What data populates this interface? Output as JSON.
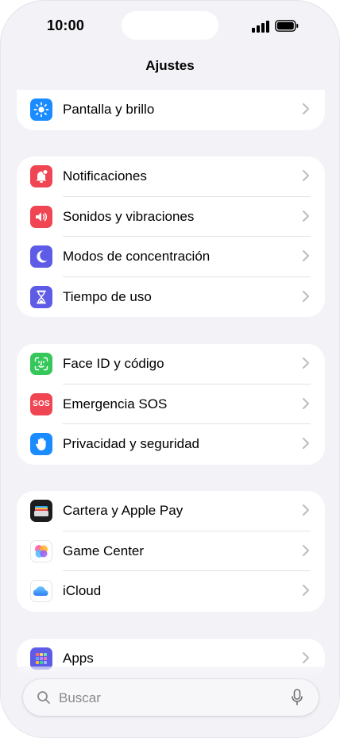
{
  "status_bar": {
    "time": "10:00"
  },
  "nav": {
    "title": "Ajustes"
  },
  "groups": [
    {
      "rows": [
        {
          "label": "Pantalla y brillo",
          "icon": "sun-icon",
          "color": "#1a8cff"
        }
      ]
    },
    {
      "rows": [
        {
          "label": "Notificaciones",
          "icon": "bell-icon",
          "color": "#f04552"
        },
        {
          "label": "Sonidos y vibraciones",
          "icon": "speaker-icon",
          "color": "#f04552"
        },
        {
          "label": "Modos de concentración",
          "icon": "moon-icon",
          "color": "#5e5ce6"
        },
        {
          "label": "Tiempo de uso",
          "icon": "hourglass-icon",
          "color": "#5e5ce6"
        }
      ]
    },
    {
      "rows": [
        {
          "label": "Face ID y código",
          "icon": "face-id-icon",
          "color": "#34c759"
        },
        {
          "label": "Emergencia SOS",
          "icon": "sos-icon",
          "color": "#f04552",
          "icon_text": "SOS"
        },
        {
          "label": "Privacidad y seguridad",
          "icon": "hand-icon",
          "color": "#1a8cff"
        }
      ]
    },
    {
      "rows": [
        {
          "label": "Cartera y Apple Pay",
          "icon": "wallet-icon",
          "color": "#1c1c1e"
        },
        {
          "label": "Game Center",
          "icon": "game-center-icon",
          "color": "#ffffff"
        },
        {
          "label": "iCloud",
          "icon": "icloud-icon",
          "color": "#ffffff"
        }
      ]
    },
    {
      "rows": [
        {
          "label": "Apps",
          "icon": "apps-grid-icon",
          "color": "#5e5ce6"
        }
      ]
    }
  ],
  "search": {
    "placeholder": "Buscar"
  }
}
